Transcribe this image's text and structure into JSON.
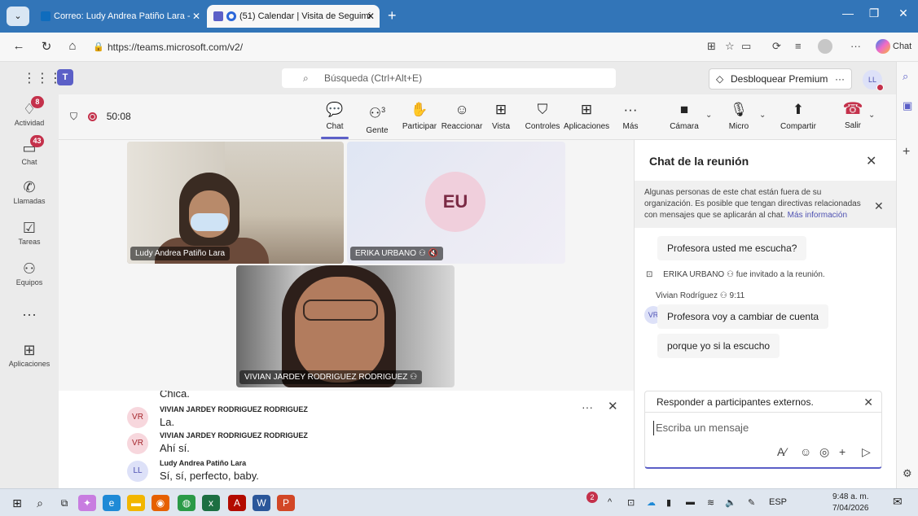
{
  "browser": {
    "tabs": [
      {
        "label": "Correo: Ludy Andrea Patiño Lara - ",
        "active": false
      },
      {
        "label": "(51) Calendar | Visita de Seguimi",
        "active": true
      }
    ],
    "url": "https://teams.microsoft.com/v2/",
    "chat_label": "Chat"
  },
  "teams_header": {
    "search_placeholder": "Búsqueda (Ctrl+Alt+E)",
    "premium_label": "Desbloquear Premium",
    "avatar_initials": "LL"
  },
  "rail": [
    {
      "label": "Actividad",
      "icon": "bell-icon",
      "badge": "8"
    },
    {
      "label": "Chat",
      "icon": "chat-icon",
      "badge": "43"
    },
    {
      "label": "Llamadas",
      "icon": "phone-icon",
      "badge": ""
    },
    {
      "label": "Tareas",
      "icon": "tasks-icon",
      "badge": ""
    },
    {
      "label": "Equipos",
      "icon": "teams-icon",
      "badge": ""
    },
    {
      "label": "",
      "icon": "more-icon",
      "badge": ""
    },
    {
      "label": "Aplicaciones",
      "icon": "apps-icon",
      "badge": ""
    }
  ],
  "meeting": {
    "timer": "50:08",
    "toolbar": [
      {
        "label": "Chat",
        "icon": "chat-icon",
        "active": true
      },
      {
        "label": "Gente",
        "icon": "people-icon",
        "count": "3"
      },
      {
        "label": "Participar",
        "icon": "raise-hand-icon"
      },
      {
        "label": "Reaccionar",
        "icon": "emoji-icon"
      },
      {
        "label": "Vista",
        "icon": "view-icon"
      },
      {
        "label": "Controles",
        "icon": "controls-icon"
      },
      {
        "label": "Aplicaciones",
        "icon": "apps-icon"
      },
      {
        "label": "Más",
        "icon": "more-icon"
      },
      {
        "label": "Cámara",
        "icon": "camera-icon"
      },
      {
        "label": "Micro",
        "icon": "mic-icon"
      },
      {
        "label": "Compartir",
        "icon": "share-icon"
      },
      {
        "label": "Salir",
        "icon": "hangup-icon"
      }
    ],
    "participants": [
      {
        "name": "Ludy Andrea Patiño Lara"
      },
      {
        "name": "ERIKA URBANO",
        "initials": "EU"
      },
      {
        "name": "VIVIAN JARDEY RODRIGUEZ RODRIGUEZ"
      }
    ]
  },
  "captions": [
    {
      "initials": "",
      "name": "",
      "text": "Chica."
    },
    {
      "initials": "VR",
      "name": "VIVIAN JARDEY RODRIGUEZ RODRIGUEZ",
      "text": "La."
    },
    {
      "initials": "VR",
      "name": "VIVIAN JARDEY RODRIGUEZ RODRIGUEZ",
      "text": "Ahí sí."
    },
    {
      "initials": "LL",
      "name": "Ludy Andrea Patiño Lara",
      "text": "Sí, sí, perfecto, baby."
    }
  ],
  "chat": {
    "title": "Chat de la reunión",
    "notice": "Algunas personas de este chat están fuera de su organización. Es posible que tengan directivas relacionadas con mensajes que se aplicarán al chat.",
    "notice_link": "Más información",
    "messages": [
      {
        "type": "bubble",
        "text": "Profesora usted me escucha?"
      },
      {
        "type": "system",
        "name": "ERIKA URBANO",
        "text": "fue invitado a la reunión."
      },
      {
        "type": "meta",
        "name": "Vivian Rodríguez",
        "time": "9:11"
      },
      {
        "type": "bubble",
        "initials": "VR",
        "text": "Profesora voy a cambiar de cuenta"
      },
      {
        "type": "bubble",
        "text": "porque yo si la escucho"
      }
    ],
    "reply_label": "Responder a participantes externos.",
    "input_placeholder": "Escriba un mensaje"
  },
  "taskbar": {
    "language": "ESP",
    "time": "9:48 a. m.",
    "date": "7/04/2026",
    "notification_badge": "2"
  }
}
